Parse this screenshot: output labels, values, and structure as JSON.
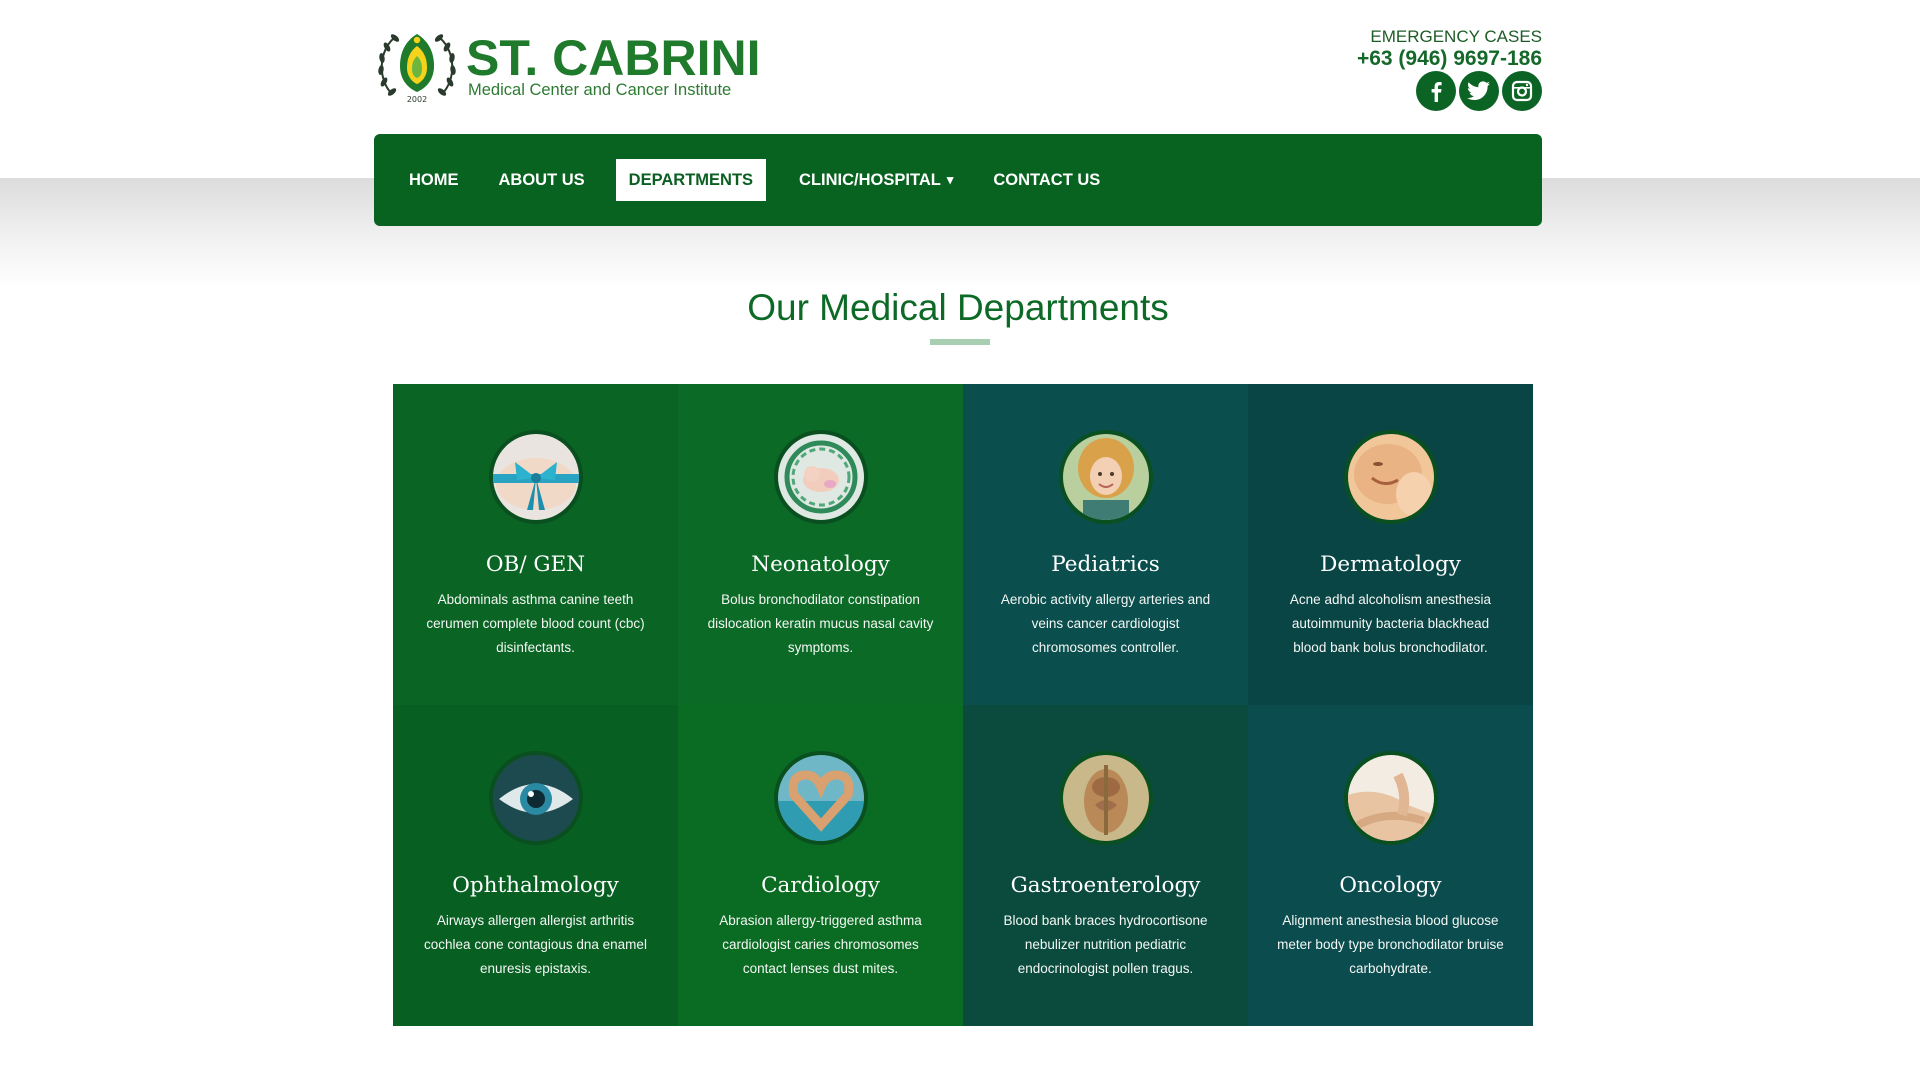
{
  "brand": {
    "name": "ST. CABRINI",
    "subtitle": "Medical Center and Cancer Institute",
    "logo_year": "2002"
  },
  "emergency": {
    "label": "EMERGENCY CASES",
    "phone": "+63 (946) 9697-186"
  },
  "social": [
    {
      "icon": "facebook-icon"
    },
    {
      "icon": "twitter-icon"
    },
    {
      "icon": "instagram-icon"
    }
  ],
  "nav": {
    "items": [
      {
        "label": "HOME"
      },
      {
        "label": "ABOUT US"
      },
      {
        "label": "DEPARTMENTS",
        "active": true
      },
      {
        "label": "CLINIC/HOSPITAL",
        "dropdown": true
      },
      {
        "label": "CONTACT US"
      }
    ],
    "caret": "▾"
  },
  "section": {
    "title": "Our Medical Departments"
  },
  "departments": [
    {
      "name": "OB/ GEN",
      "description": "Abdominals asthma canine teeth cerumen complete blood count (cbc) disinfectants.",
      "tile_color": "#0a6424",
      "photo": "gift-ribbon"
    },
    {
      "name": "Neonatology",
      "description": "Bolus bronchodilator constipation dislocation keratin mucus nasal cavity symptoms.",
      "tile_color": "#0b6a26",
      "photo": "newborn-in-nest"
    },
    {
      "name": "Pediatrics",
      "description": "Aerobic activity allergy arteries and veins cancer cardiologist chromosomes controller.",
      "tile_color": "#0a4e4e",
      "photo": "smiling-girl"
    },
    {
      "name": "Dermatology",
      "description": "Acne adhd alcoholism anesthesia autoimmunity bacteria blackhead blood bank bolus bronchodilator.",
      "tile_color": "#0a4545",
      "photo": "skin-face"
    },
    {
      "name": "Ophthalmology",
      "description": "Airways allergen allergist arthritis cochlea cone contagious dna enamel enuresis epistaxis.",
      "tile_color": "#075f22",
      "photo": "blue-eye"
    },
    {
      "name": "Cardiology",
      "description": "Abrasion allergy-triggered asthma cardiologist caries chromosomes contact lenses dust mites.",
      "tile_color": "#0a6c22",
      "photo": "heart-hands"
    },
    {
      "name": "Gastroenterology",
      "description": "Blood bank braces hydrocortisone nebulizer nutrition pediatric endocrinologist pollen tragus.",
      "tile_color": "#0a4b3e",
      "photo": "anatomy-torso"
    },
    {
      "name": "Oncology",
      "description": "Alignment anesthesia blood glucose meter body type bronchodilator bruise carbohydrate.",
      "tile_color": "#0b4c4f",
      "photo": "arm-care"
    }
  ]
}
